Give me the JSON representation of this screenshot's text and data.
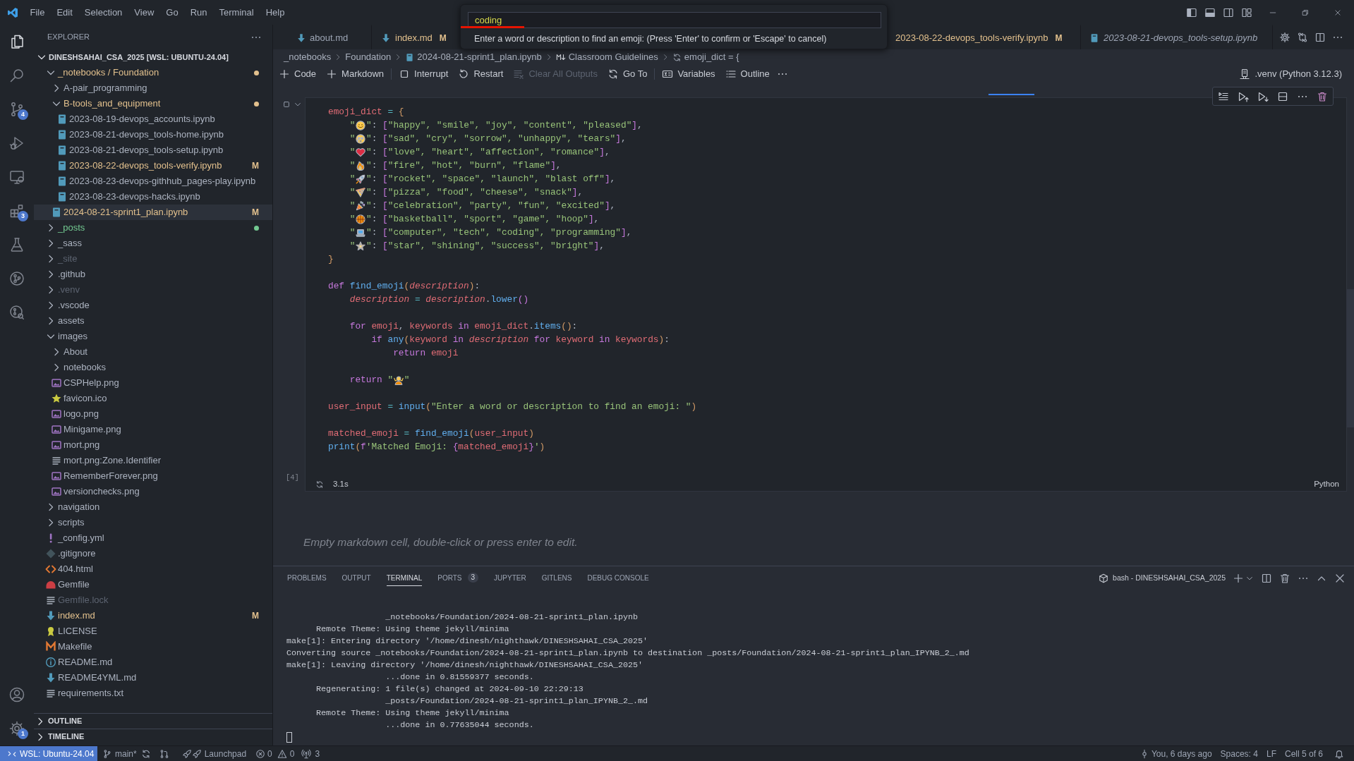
{
  "title_bar": {
    "menus": [
      "File",
      "Edit",
      "Selection",
      "View",
      "Go",
      "Run",
      "Terminal",
      "Help"
    ]
  },
  "quick_input": {
    "value": "coding",
    "message": "Enter a word or description to find an emoji: (Press 'Enter' to confirm or 'Escape' to cancel)"
  },
  "activity_bar": {
    "items": [
      {
        "kind": "explorer",
        "selected": true
      },
      {
        "kind": "search",
        "selected": false
      },
      {
        "kind": "source-control",
        "selected": false,
        "badge": "4"
      },
      {
        "kind": "run",
        "selected": false
      },
      {
        "kind": "remote",
        "selected": false
      },
      {
        "kind": "extensions",
        "selected": false,
        "badge": "3"
      },
      {
        "kind": "testing",
        "selected": false
      },
      {
        "kind": "graph",
        "selected": false
      },
      {
        "kind": "inspect",
        "selected": false
      }
    ],
    "bottom": [
      {
        "kind": "account"
      },
      {
        "kind": "manage",
        "badge": "1"
      }
    ]
  },
  "sidebar": {
    "title": "EXPLORER",
    "root": {
      "label": "DINESHSAHAI_CSA_2025 [WSL: UBUNTU-24.04]",
      "expanded": true,
      "children": [
        {
          "label": "_notebooks / Foundation",
          "kind": "folder",
          "expanded": true,
          "color": "#e2c08d",
          "dot": true,
          "selected": false,
          "children": [
            {
              "label": "A-pair_programming",
              "kind": "folder",
              "expanded": false,
              "color": "#abb2bf",
              "dot": false,
              "selected": false
            },
            {
              "label": "B-tools_and_equipment",
              "kind": "folder",
              "expanded": true,
              "color": "#e2c08d",
              "dot": true,
              "selected": false,
              "children": [
                {
                  "label": "2023-08-19-devops_accounts.ipynb",
                  "kind": "notebook",
                  "color": "#abb2bf",
                  "selected": false
                },
                {
                  "label": "2023-08-21-devops_tools-home.ipynb",
                  "kind": "notebook",
                  "color": "#abb2bf",
                  "selected": false
                },
                {
                  "label": "2023-08-21-devops_tools-setup.ipynb",
                  "kind": "notebook",
                  "color": "#abb2bf",
                  "selected": false
                },
                {
                  "label": "2023-08-22-devops_tools-verify.ipynb",
                  "kind": "notebook",
                  "color": "#e2c08d",
                  "badge": "M",
                  "selected": false
                },
                {
                  "label": "2023-08-23-devops-githhub_pages-play.ipynb",
                  "kind": "notebook",
                  "color": "#abb2bf",
                  "selected": false
                },
                {
                  "label": "2023-08-23-devops-hacks.ipynb",
                  "kind": "notebook",
                  "color": "#abb2bf",
                  "selected": false
                }
              ]
            },
            {
              "label": "2024-08-21-sprint1_plan.ipynb",
              "kind": "notebook",
              "color": "#e2c08d",
              "badge": "M",
              "selected": true
            }
          ]
        },
        {
          "label": "_posts",
          "kind": "folder",
          "expanded": false,
          "color": "#73c991",
          "dot": true,
          "selected": false
        },
        {
          "label": "_sass",
          "kind": "folder",
          "expanded": false,
          "color": "#abb2bf",
          "dot": false,
          "selected": false
        },
        {
          "label": "_site",
          "kind": "folder",
          "expanded": false,
          "color": "#5c6370",
          "dot": false,
          "selected": false
        },
        {
          "label": ".github",
          "kind": "folder",
          "expanded": false,
          "color": "#abb2bf",
          "dot": false,
          "selected": false
        },
        {
          "label": ".venv",
          "kind": "folder",
          "expanded": false,
          "color": "#5c6370",
          "dot": false,
          "selected": false
        },
        {
          "label": ".vscode",
          "kind": "folder",
          "expanded": false,
          "color": "#abb2bf",
          "dot": false,
          "selected": false
        },
        {
          "label": "assets",
          "kind": "folder",
          "expanded": false,
          "color": "#abb2bf",
          "dot": false,
          "selected": false
        },
        {
          "label": "images",
          "kind": "folder",
          "expanded": true,
          "color": "#abb2bf",
          "dot": false,
          "selected": false,
          "children": [
            {
              "label": "About",
              "kind": "folder",
              "expanded": false,
              "color": "#abb2bf",
              "dot": false,
              "selected": false
            },
            {
              "label": "notebooks",
              "kind": "folder",
              "expanded": false,
              "color": "#abb2bf",
              "dot": false,
              "selected": false
            },
            {
              "label": "CSPHelp.png",
              "kind": "image",
              "color": "#abb2bf",
              "selected": false
            },
            {
              "label": "favicon.ico",
              "kind": "favicon",
              "color": "#abb2bf",
              "selected": false
            },
            {
              "label": "logo.png",
              "kind": "image",
              "color": "#abb2bf",
              "selected": false
            },
            {
              "label": "Minigame.png",
              "kind": "image",
              "color": "#abb2bf",
              "selected": false
            },
            {
              "label": "mort.png",
              "kind": "image",
              "color": "#abb2bf",
              "selected": false
            },
            {
              "label": "mort.png:Zone.Identifier",
              "kind": "text",
              "color": "#abb2bf",
              "selected": false
            },
            {
              "label": "RememberForever.png",
              "kind": "image",
              "color": "#abb2bf",
              "selected": false
            },
            {
              "label": "versionchecks.png",
              "kind": "image",
              "color": "#abb2bf",
              "selected": false
            }
          ]
        },
        {
          "label": "navigation",
          "kind": "folder",
          "expanded": false,
          "color": "#abb2bf",
          "dot": false,
          "selected": false
        },
        {
          "label": "scripts",
          "kind": "folder",
          "expanded": false,
          "color": "#abb2bf",
          "dot": false,
          "selected": false
        },
        {
          "label": "_config.yml",
          "kind": "yaml",
          "color": "#abb2bf",
          "selected": false
        },
        {
          "label": ".gitignore",
          "kind": "git",
          "color": "#abb2bf",
          "selected": false
        },
        {
          "label": "404.html",
          "kind": "html",
          "color": "#abb2bf",
          "selected": false
        },
        {
          "label": "Gemfile",
          "kind": "gem",
          "color": "#abb2bf",
          "selected": false
        },
        {
          "label": "Gemfile.lock",
          "kind": "text",
          "color": "#5c6370",
          "selected": false
        },
        {
          "label": "index.md",
          "kind": "markdown",
          "color": "#e2c08d",
          "badge": "M",
          "selected": false
        },
        {
          "label": "LICENSE",
          "kind": "license",
          "color": "#abb2bf",
          "selected": false
        },
        {
          "label": "Makefile",
          "kind": "make",
          "color": "#abb2bf",
          "selected": false
        },
        {
          "label": "README.md",
          "kind": "info",
          "color": "#abb2bf",
          "selected": false
        },
        {
          "label": "README4YML.md",
          "kind": "markdown",
          "color": "#abb2bf",
          "selected": false
        },
        {
          "label": "requirements.txt",
          "kind": "text",
          "color": "#abb2bf",
          "selected": false
        }
      ]
    },
    "sections": [
      {
        "label": "OUTLINE",
        "expanded": false
      },
      {
        "label": "TIMELINE",
        "expanded": false
      }
    ]
  },
  "tabs": [
    {
      "label": "about.md",
      "kind": "markdown",
      "color": "#9da5b4",
      "selected": false,
      "preview": false
    },
    {
      "label": "index.md",
      "kind": "markdown",
      "color": "#e2c08d",
      "badge": "M",
      "selected": false,
      "preview": false
    },
    {
      "label": "2023-08-22-devops_tools-verify.ipynb",
      "color": "#e2c08d",
      "badge": "M",
      "selected": false,
      "preview": false
    },
    {
      "label": "2023-08-21-devops_tools-setup.ipynb",
      "kind": "notebook",
      "color": "#9da5b4",
      "selected": false,
      "preview": true
    }
  ],
  "breadcrumbs": [
    {
      "label": "_notebooks",
      "kind": "folder"
    },
    {
      "label": "Foundation",
      "kind": "folder"
    },
    {
      "label": "2024-08-21-sprint1_plan.ipynb",
      "kind": "notebook"
    },
    {
      "label": "Classroom Guidelines",
      "kind": "heading"
    },
    {
      "label": "emoji_dict = {",
      "kind": "symbol"
    }
  ],
  "notebook_toolbar": {
    "groups": [
      [
        {
          "label": "Code",
          "kind": "add",
          "disabled": false
        },
        {
          "label": "Markdown",
          "kind": "add",
          "disabled": false
        }
      ],
      [
        {
          "label": "Interrupt",
          "kind": "interrupt",
          "disabled": false
        },
        {
          "label": "Restart",
          "kind": "restart",
          "disabled": false
        },
        {
          "label": "Clear All Outputs",
          "kind": "clear",
          "disabled": true
        },
        {
          "label": "Go To",
          "kind": "goto",
          "disabled": false
        }
      ],
      [
        {
          "label": "Variables",
          "kind": "variables",
          "disabled": false
        },
        {
          "label": "Outline",
          "kind": "outline",
          "disabled": false
        }
      ]
    ],
    "kernel": ".venv (Python 3.12.3)"
  },
  "code_cell": {
    "execution_count": "[4]",
    "duration": "3.1s",
    "language": "Python",
    "blocks": [
      [
        [
          {
            "text": "emoji_dict",
            "kind": "var"
          },
          {
            "text": " = ",
            "kind": "op"
          },
          {
            "text": "{",
            "kind": "br"
          }
        ],
        [
          {
            "text": "    \"",
            "kind": "str"
          },
          {
            "kind": "smile"
          },
          {
            "text": "\"",
            "kind": "str"
          },
          {
            "text": ": ",
            "kind": "plain"
          },
          {
            "text": "[",
            "kind": "br2"
          },
          {
            "text": "\"happy\", \"smile\", \"joy\", \"content\", \"pleased\"",
            "kind": "str"
          },
          {
            "text": "]",
            "kind": "br2"
          },
          {
            "text": ",",
            "kind": "plain"
          }
        ],
        [
          {
            "text": "    \"",
            "kind": "str"
          },
          {
            "kind": "tears"
          },
          {
            "text": "\"",
            "kind": "str"
          },
          {
            "text": ": ",
            "kind": "plain"
          },
          {
            "text": "[",
            "kind": "br2"
          },
          {
            "text": "\"sad\", \"cry\", \"sorrow\", \"unhappy\", \"tears\"",
            "kind": "str"
          },
          {
            "text": "]",
            "kind": "br2"
          },
          {
            "text": ",",
            "kind": "plain"
          }
        ],
        [
          {
            "text": "    \"",
            "kind": "str"
          },
          {
            "kind": "heart"
          },
          {
            "text": "\"",
            "kind": "str"
          },
          {
            "text": ": ",
            "kind": "plain"
          },
          {
            "text": "[",
            "kind": "br2"
          },
          {
            "text": "\"love\", \"heart\", \"affection\", \"romance\"",
            "kind": "str"
          },
          {
            "text": "]",
            "kind": "br2"
          },
          {
            "text": ",",
            "kind": "plain"
          }
        ],
        [
          {
            "text": "    \"",
            "kind": "str"
          },
          {
            "kind": "fire"
          },
          {
            "text": "\"",
            "kind": "str"
          },
          {
            "text": ": ",
            "kind": "plain"
          },
          {
            "text": "[",
            "kind": "br2"
          },
          {
            "text": "\"fire\", \"hot\", \"burn\", \"flame\"",
            "kind": "str"
          },
          {
            "text": "]",
            "kind": "br2"
          },
          {
            "text": ",",
            "kind": "plain"
          }
        ],
        [
          {
            "text": "    \"",
            "kind": "str"
          },
          {
            "kind": "rocket"
          },
          {
            "text": "\"",
            "kind": "str"
          },
          {
            "text": ": ",
            "kind": "plain"
          },
          {
            "text": "[",
            "kind": "br2"
          },
          {
            "text": "\"rocket\", \"space\", \"launch\", \"blast off\"",
            "kind": "str"
          },
          {
            "text": "]",
            "kind": "br2"
          },
          {
            "text": ",",
            "kind": "plain"
          }
        ],
        [
          {
            "text": "    \"",
            "kind": "str"
          },
          {
            "kind": "pizza"
          },
          {
            "text": "\"",
            "kind": "str"
          },
          {
            "text": ": ",
            "kind": "plain"
          },
          {
            "text": "[",
            "kind": "br2"
          },
          {
            "text": "\"pizza\", \"food\", \"cheese\", \"snack\"",
            "kind": "str"
          },
          {
            "text": "]",
            "kind": "br2"
          },
          {
            "text": ",",
            "kind": "plain"
          }
        ],
        [
          {
            "text": "    \"",
            "kind": "str"
          },
          {
            "kind": "party"
          },
          {
            "text": "\"",
            "kind": "str"
          },
          {
            "text": ": ",
            "kind": "plain"
          },
          {
            "text": "[",
            "kind": "br2"
          },
          {
            "text": "\"celebration\", \"party\", \"fun\", \"excited\"",
            "kind": "str"
          },
          {
            "text": "]",
            "kind": "br2"
          },
          {
            "text": ",",
            "kind": "plain"
          }
        ],
        [
          {
            "text": "    \"",
            "kind": "str"
          },
          {
            "kind": "ball"
          },
          {
            "text": "\"",
            "kind": "str"
          },
          {
            "text": ": ",
            "kind": "plain"
          },
          {
            "text": "[",
            "kind": "br2"
          },
          {
            "text": "\"basketball\", \"sport\", \"game\", \"hoop\"",
            "kind": "str"
          },
          {
            "text": "]",
            "kind": "br2"
          },
          {
            "text": ",",
            "kind": "plain"
          }
        ],
        [
          {
            "text": "    \"",
            "kind": "str"
          },
          {
            "kind": "laptop"
          },
          {
            "text": "\"",
            "kind": "str"
          },
          {
            "text": ": ",
            "kind": "plain"
          },
          {
            "text": "[",
            "kind": "br2"
          },
          {
            "text": "\"computer\", \"tech\", \"coding\", \"programming\"",
            "kind": "str"
          },
          {
            "text": "]",
            "kind": "br2"
          },
          {
            "text": ",",
            "kind": "plain"
          }
        ],
        [
          {
            "text": "    \"",
            "kind": "str"
          },
          {
            "kind": "star"
          },
          {
            "text": "\"",
            "kind": "str"
          },
          {
            "text": ": ",
            "kind": "plain"
          },
          {
            "text": "[",
            "kind": "br2"
          },
          {
            "text": "\"star\", \"shining\", \"success\", \"bright\"",
            "kind": "str"
          },
          {
            "text": "]",
            "kind": "br2"
          },
          {
            "text": ",",
            "kind": "plain"
          }
        ],
        [
          {
            "text": "}",
            "kind": "br"
          }
        ]
      ],
      [
        [
          {
            "text": "def ",
            "kind": "kw"
          },
          {
            "text": "find_emoji",
            "kind": "fn"
          },
          {
            "text": "(",
            "kind": "br"
          },
          {
            "text": "description",
            "kind": "param"
          },
          {
            "text": ")",
            "kind": "br"
          },
          {
            "text": ":",
            "kind": "plain"
          }
        ],
        [
          {
            "text": "    description",
            "kind": "param"
          },
          {
            "text": " = ",
            "kind": "op"
          },
          {
            "text": "description",
            "kind": "param"
          },
          {
            "text": ".",
            "kind": "plain"
          },
          {
            "text": "lower",
            "kind": "fn"
          },
          {
            "text": "()",
            "kind": "br2"
          }
        ]
      ],
      [
        [
          {
            "text": "    for",
            "kind": "kw"
          },
          {
            "text": " emoji",
            "kind": "var"
          },
          {
            "text": ", ",
            "kind": "plain"
          },
          {
            "text": "keywords",
            "kind": "var"
          },
          {
            "text": " in ",
            "kind": "kw"
          },
          {
            "text": "emoji_dict",
            "kind": "var"
          },
          {
            "text": ".",
            "kind": "plain"
          },
          {
            "text": "items",
            "kind": "fn"
          },
          {
            "text": "()",
            "kind": "br"
          },
          {
            "text": ":",
            "kind": "plain"
          }
        ],
        [
          {
            "text": "        if ",
            "kind": "kw"
          },
          {
            "text": "any",
            "kind": "fn"
          },
          {
            "text": "(",
            "kind": "br"
          },
          {
            "text": "keyword",
            "kind": "var"
          },
          {
            "text": " in ",
            "kind": "kw"
          },
          {
            "text": "description",
            "kind": "param"
          },
          {
            "text": " for ",
            "kind": "kw"
          },
          {
            "text": "keyword",
            "kind": "var"
          },
          {
            "text": " in ",
            "kind": "kw"
          },
          {
            "text": "keywords",
            "kind": "var"
          },
          {
            "text": ")",
            "kind": "br"
          },
          {
            "text": ":",
            "kind": "plain"
          }
        ],
        [
          {
            "text": "            return",
            "kind": "kw"
          },
          {
            "text": " emoji",
            "kind": "var"
          }
        ]
      ],
      [
        [
          {
            "text": "    return",
            "kind": "kw"
          },
          {
            "text": " \"",
            "kind": "str"
          },
          {
            "kind": "shrug"
          },
          {
            "text": "\"",
            "kind": "str"
          }
        ]
      ],
      [
        [
          {
            "text": "user_input",
            "kind": "var"
          },
          {
            "text": " = ",
            "kind": "op"
          },
          {
            "text": "input",
            "kind": "fn"
          },
          {
            "text": "(",
            "kind": "br"
          },
          {
            "text": "\"Enter a word or description to find an emoji: \"",
            "kind": "str"
          },
          {
            "text": ")",
            "kind": "br"
          }
        ]
      ],
      [
        [
          {
            "text": "matched_emoji",
            "kind": "var"
          },
          {
            "text": " = ",
            "kind": "op"
          },
          {
            "text": "find_emoji",
            "kind": "fn"
          },
          {
            "text": "(",
            "kind": "br"
          },
          {
            "text": "user_input",
            "kind": "var"
          },
          {
            "text": ")",
            "kind": "br"
          }
        ],
        [
          {
            "text": "print",
            "kind": "fn"
          },
          {
            "text": "(",
            "kind": "br"
          },
          {
            "text": "f",
            "kind": "kw"
          },
          {
            "text": "'Matched Emoji: ",
            "kind": "str"
          },
          {
            "text": "{",
            "kind": "br2"
          },
          {
            "text": "matched_emoji",
            "kind": "var"
          },
          {
            "text": "}",
            "kind": "br2"
          },
          {
            "text": "'",
            "kind": "str"
          },
          {
            "text": ")",
            "kind": "br"
          }
        ]
      ]
    ]
  },
  "markdown_cell": {
    "text": "Empty markdown cell, double-click or press enter to edit."
  },
  "panel": {
    "tabs": [
      {
        "label": "PROBLEMS",
        "selected": false
      },
      {
        "label": "OUTPUT",
        "selected": false
      },
      {
        "label": "TERMINAL",
        "selected": true
      },
      {
        "label": "PORTS",
        "selected": false,
        "badge": "3"
      },
      {
        "label": "JUPYTER",
        "selected": false
      },
      {
        "label": "GITLENS",
        "selected": false
      },
      {
        "label": "DEBUG CONSOLE",
        "selected": false
      }
    ],
    "terminal": {
      "profile": "bash - DINESHSAHAI_CSA_2025",
      "lines": [
        "                    _notebooks/Foundation/2024-08-21-sprint1_plan.ipynb",
        "      Remote Theme: Using theme jekyll/minima",
        "make[1]: Entering directory '/home/dinesh/nighthawk/DINESHSAHAI_CSA_2025'",
        "Converting source _notebooks/Foundation/2024-08-21-sprint1_plan.ipynb to destination _posts/Foundation/2024-08-21-sprint1_plan_IPYNB_2_.md",
        "make[1]: Leaving directory '/home/dinesh/nighthawk/DINESHSAHAI_CSA_2025'",
        "                    ...done in 0.81559377 seconds.",
        "      Regenerating: 1 file(s) changed at 2024-09-10 22:29:13",
        "                    _posts/Foundation/2024-08-21-sprint1_plan_IPYNB_2_.md",
        "      Remote Theme: Using theme jekyll/minima",
        "                    ...done in 0.77635044 seconds."
      ]
    }
  },
  "status_bar": {
    "remote": "WSL: Ubuntu-24.04",
    "branch": "main*",
    "launchpad": "Launchpad",
    "errors": "0",
    "warnings": "0",
    "ports": "3",
    "blame": "You, 6 days ago",
    "indentation": "Spaces: 4",
    "eol": "LF",
    "cell": "Cell 5 of 6"
  }
}
